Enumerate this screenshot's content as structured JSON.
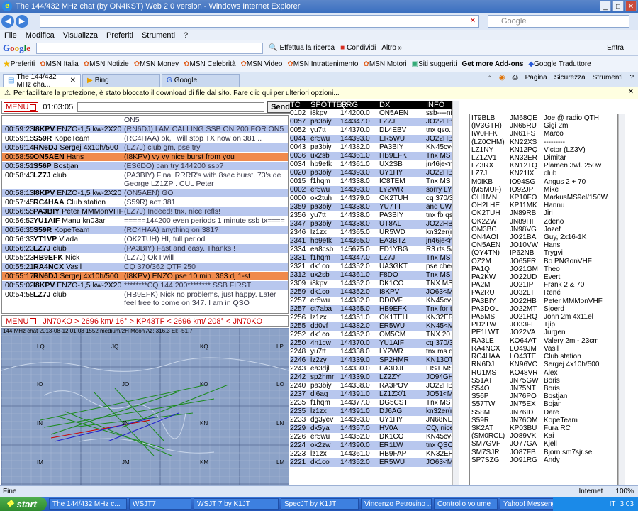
{
  "window": {
    "title": "The 144/432 MHz chat (by ON4KST) Web 2.0 version - Windows Internet Explorer"
  },
  "browser": {
    "search_placeholder": "Google",
    "menu": [
      "File",
      "Modifica",
      "Visualizza",
      "Preferiti",
      "Strumenti",
      "?"
    ],
    "google_buttons": [
      "Effettua la ricerca",
      "Condividi",
      "Altro »"
    ],
    "google_right": "Entra",
    "favorites_label": "Preferiti",
    "favorites": [
      "MSN Italia",
      "MSN Notizie",
      "MSN Money",
      "MSN Celebrità",
      "MSN Video",
      "MSN Intrattenimento",
      "MSN Motori",
      "Siti suggeriti",
      "Get more Add-ons",
      "Google Traduttore"
    ],
    "tabs": [
      "The 144/432 MHz cha...",
      "Bing",
      "Google"
    ],
    "tools": [
      "Pagina",
      "Sicurezza",
      "Strumenti"
    ],
    "infobar": "Per facilitare la protezione, è stato bloccato il download di file dal sito. Fare clic qui per ulteriori opzioni...",
    "status_left": "Fine",
    "status_zone": "Internet",
    "zoom": "100%"
  },
  "chat": {
    "menu_label": "MENU",
    "clock": "01:03:05",
    "send_label": "Send",
    "rows": [
      {
        "time": "",
        "call": "",
        "name": "",
        "msg": "ON5",
        "style": "white"
      },
      {
        "time": "00:59:23",
        "call": "I8KPV",
        "name": "ENZO-1,5 kw-2X20",
        "msg": "(RN6DJ) I AM CALLING SSB ON 200 FOR ON5",
        "style": "blue"
      },
      {
        "time": "00:59:15",
        "call": "S59R",
        "name": "KopeTeam",
        "msg": "(RC4HAA) ok, i will stop TX now on 381 ..",
        "style": "white"
      },
      {
        "time": "00:59:14",
        "call": "RN6DJ",
        "name": "Sergej 4x10h/500",
        "msg": "(LZ7J) club gm, pse try",
        "style": "blue"
      },
      {
        "time": "00:58:59",
        "call": "ON5AEN",
        "name": "Hans",
        "msg": "(I8KPV) vy vy nice burst from you",
        "style": "orange"
      },
      {
        "time": "00:58:51",
        "call": "S56P",
        "name": "Bostjan",
        "msg": "(ES6DO) can try 144200 ssb?",
        "style": "blue"
      },
      {
        "time": "00:58:43",
        "call": "LZ7J",
        "name": "club",
        "msg": "(PA3BIY) Final RRRR's with 8sec burst. 73's de George LZ1ZP . CUL Peter",
        "style": "white"
      },
      {
        "time": "00:58:13",
        "call": "I8KPV",
        "name": "ENZO-1,5 kw-2X20",
        "msg": "(ON5AEN) GO",
        "style": "blue"
      },
      {
        "time": "00:57:45",
        "call": "RC4HAA",
        "name": "Club station",
        "msg": "(S59R) вот 381",
        "style": "white"
      },
      {
        "time": "00:56:55",
        "call": "PA3BIY",
        "name": "Peter MMMonVHF",
        "msg": "(LZ7J) Indeed! tnx, nice refls!",
        "style": "blue"
      },
      {
        "time": "00:56:52",
        "call": "YU1AIF",
        "name": "Manu kn03ar",
        "msg": "=====144200 even periods 1 minute ssb tx====",
        "style": "white"
      },
      {
        "time": "00:56:35",
        "call": "S59R",
        "name": "KopeTeam",
        "msg": "(RC4HAA) anything on 381?",
        "style": "blue"
      },
      {
        "time": "00:56:33",
        "call": "YT1VP",
        "name": "Vlada",
        "msg": "(OK2TUH) HI, full period",
        "style": "white"
      },
      {
        "time": "00:56:23",
        "call": "LZ7J",
        "name": "club",
        "msg": "(PA3BIY) Fast and easy. Thanks !",
        "style": "blue"
      },
      {
        "time": "00:55:23",
        "call": "HB9EFK",
        "name": "Nick",
        "msg": "(LZ7J) Ok I will",
        "style": "white"
      },
      {
        "time": "00:55:21",
        "call": "RA4NCX",
        "name": "Vasil",
        "msg": "CQ 370/362 QTF 250",
        "style": "blue"
      },
      {
        "time": "00:55:17",
        "call": "RN6DJ",
        "name": "Sergej 4x10h/500",
        "msg": "(I8KPV) ENZO pse 10 min. 363 dj 1-st",
        "style": "orange"
      },
      {
        "time": "00:55:02",
        "call": "I8KPV",
        "name": "ENZO-1,5 kw-2X20",
        "msg": "********CQ 144.200******** SSB FIRST",
        "style": "blue"
      },
      {
        "time": "00:54:58",
        "call": "LZ7J",
        "name": "club",
        "msg": "(HB9EFK) Nick no problems, just happy. Later feel free to come on 347. I am in QSO",
        "style": "white"
      }
    ]
  },
  "map": {
    "menu_label": "MENU",
    "path_text": "JN70KO > 2696 km/ 16° > KP43TF < 2696 km/ 208° < JN70KO",
    "caption": "144 MHz chat  2013-08-12 01:03 1552 medium/2H  Moon Az: 316.3 El: -51.7",
    "labels": [
      "LQ",
      "JQ",
      "KQ",
      "LP",
      "IO",
      "JO",
      "KO",
      "LO",
      "IN",
      "JN",
      "KN",
      "LN",
      "IM",
      "JM",
      "KM",
      "LM"
    ]
  },
  "spotter": {
    "headers": [
      "TC",
      "SPOTTER",
      "QRG",
      "DX",
      "INFO"
    ],
    "rows": [
      [
        "0102",
        "i8kpv",
        "144200.0",
        "ON5AEN",
        "ssb----nice b"
      ],
      [
        "0057",
        "pa3biy",
        "144347.0",
        "LZ7J",
        "JO22HB<MS"
      ],
      [
        "0052",
        "yu7tt",
        "144370.0",
        "DL4EBV",
        "tnx qso..73"
      ],
      [
        "0044",
        "er5wu",
        "144393.0",
        "ER5WU",
        "JO22HB<MS"
      ],
      [
        "0043",
        "pa3biy",
        "144382.0",
        "PA3BIY",
        "KN45cv<MS"
      ],
      [
        "0036",
        "ux2sb",
        "144361.0",
        "HB9EFK",
        "Tnx MS QSO"
      ],
      [
        "0034",
        "hb9efk",
        "144361.0",
        "UX2SB",
        "jn46je<ms>"
      ],
      [
        "0020",
        "pa3biy",
        "144393.0",
        "UY1HY",
        "JO22HB<MS"
      ],
      [
        "0015",
        "f1hqm",
        "144338.0",
        "IC8TEM",
        "Tnx MS qso"
      ],
      [
        "0002",
        "er5wu",
        "144393.0",
        "LY2WR",
        "sorry LY!!! C"
      ],
      [
        "0000",
        "ok2tuh",
        "144379.0",
        "OK2TUH",
        "cq 370/379"
      ],
      [
        "2359",
        "pa3biy",
        "144338.0",
        "YU7TT",
        "and UW8SM"
      ],
      [
        "2356",
        "yu7tt",
        "144338.0",
        "PA3BIY",
        "tnx fb qso..7"
      ],
      [
        "2347",
        "pa3biy",
        "144338.0",
        "UT8AL",
        "JO22HB<MS"
      ],
      [
        "2346",
        "lz1zx",
        "144365.0",
        "UR5WD",
        "kn32er(ms)k"
      ],
      [
        "2341",
        "hb9efk",
        "144365.0",
        "EA3BTZ",
        "jn46je<ms>"
      ],
      [
        "2334",
        "ea8csb",
        "145675.0",
        "ED1YBG",
        "R3 rts 5/9 q"
      ],
      [
        "2331",
        "f1hqm",
        "144347.0",
        "LZ7J",
        "Tnx MS qso,"
      ],
      [
        "2321",
        "dk1co",
        "144352.0",
        "UA3GKT",
        "pse check s"
      ],
      [
        "2312",
        "ux2sb",
        "144361.0",
        "F8DO",
        "Tnx MS QSO"
      ],
      [
        "2309",
        "i8kpv",
        "144352.0",
        "DK1CO",
        "TNX MS QS"
      ],
      [
        "2259",
        "dk1co",
        "144352.0",
        "I8KPV",
        "JO63<MS><"
      ],
      [
        "2257",
        "er5wu",
        "144382.0",
        "DD0VF",
        "KN45cv<MS"
      ],
      [
        "2257",
        "ct7aba",
        "144365.0",
        "HB9EFK",
        "Tnx for the M"
      ],
      [
        "2256",
        "lz1zx",
        "144351.0",
        "OK1TEH",
        "KN32ER<MS"
      ],
      [
        "2255",
        "dd0vf",
        "144382.0",
        "ER5WU",
        "KN45<MS>"
      ],
      [
        "2252",
        "dk1co",
        "144352.0",
        "OM5CM",
        "TNX 20 sec"
      ],
      [
        "2250",
        "4n1cw",
        "144370.0",
        "YU1AIF",
        "cq  370/350"
      ],
      [
        "2248",
        "yu7tt",
        "144338.0",
        "LY2WR",
        "tnx ms qso."
      ],
      [
        "2246",
        "lz2zy",
        "144339.0",
        "SP2HMR",
        "KN13OT<MS"
      ],
      [
        "2243",
        "ea3djl",
        "144330.0",
        "EA3DJL",
        "LIST MS SS"
      ],
      [
        "2242",
        "sp2hmr",
        "144339.0",
        "LZ2ZY",
        "JO94GH<MS"
      ],
      [
        "2240",
        "pa3biy",
        "144338.0",
        "RA3POV",
        "JO22HB<MS"
      ],
      [
        "2237",
        "dj6ag",
        "144391.0",
        "LZ1ZX/1",
        "JO51<MS>H"
      ],
      [
        "2235",
        "f1hqm",
        "144377.0",
        "DG5CST",
        "Tnx MS qso,"
      ],
      [
        "2235",
        "lz1zx",
        "144391.0",
        "DJ6AG",
        "kn32er(ms)j"
      ],
      [
        "2233",
        "dg3yev",
        "144393.0",
        "UY1HY",
        "JN68NL<MS"
      ],
      [
        "2229",
        "dk5ya",
        "144357.0",
        "HV0A",
        "CQ, nice bu"
      ],
      [
        "2226",
        "er5wu",
        "144352.0",
        "DK1CO",
        "KN45cv<MS"
      ],
      [
        "2224",
        "ok2zw",
        "144390.0",
        "ER1LW",
        "tnx QSO, 73"
      ],
      [
        "2223",
        "lz1zx",
        "144361.0",
        "HB9FAP",
        "KN32ER(MS"
      ],
      [
        "2221",
        "dk1co",
        "144352.0",
        "ER5WU",
        "JO63<MS><"
      ]
    ]
  },
  "users": [
    [
      "IT9BLB",
      "JM68QE",
      "Joe @ radio QTH"
    ],
    [
      "(IV3GTH)",
      "JN65RU",
      "Gigi 2m"
    ],
    [
      "IW0FFK",
      "JN61FS",
      "Marco"
    ],
    [
      "(LZ0CHM)",
      "KN22XS",
      "---------"
    ],
    [
      "LZ1NY",
      "KN12PQ",
      "Victor (LZ3V)"
    ],
    [
      "LZ1ZV1",
      "KN32ER",
      "Dimitar"
    ],
    [
      "LZ3RX",
      "KN12TQ",
      "Plamen 3wl. 250w"
    ],
    [
      "LZ7J",
      "KN21IX",
      "club"
    ],
    [
      "M0IKB",
      "IO94SG",
      "Angus 2 + 70"
    ],
    [
      "(M5MUF)",
      "IO92JP",
      "Mike"
    ],
    [
      "OH1MN",
      "KP10FO",
      "MarkusMS9el/150W"
    ],
    [
      "OH2LHE",
      "KP11MK",
      "Hannu"
    ],
    [
      "OK2TUH",
      "JN89RB",
      "Jiri"
    ],
    [
      "OK2ZW",
      "JN89HI",
      "Zdeno"
    ],
    [
      "OM3BC",
      "JN98VG",
      "Jozef"
    ],
    [
      "ON4AOI",
      "JO21BA",
      "Guy, 2x16-1K"
    ],
    [
      "ON5AEN",
      "JO10VW",
      "Hans"
    ],
    [
      "(OY4TN)",
      "IP62NB",
      "Trygvi"
    ],
    [
      "OZ2M",
      "JO65FR",
      "Bo PNGonVHF"
    ],
    [
      "PA1Q",
      "JO21GM",
      "Theo"
    ],
    [
      "PA2KW",
      "JO22UD",
      "Evert"
    ],
    [
      "PA2M",
      "JO21IP",
      "Frank 2 & 70"
    ],
    [
      "PA2RU",
      "JO32LT",
      "René"
    ],
    [
      "PA3BIY",
      "JO22HB",
      "Peter MMMonVHF"
    ],
    [
      "PA3DOL",
      "JO22MT",
      "Sjoerd"
    ],
    [
      "PA5MS",
      "JO21RQ",
      "John 2m 4x11el"
    ],
    [
      "PD2TW",
      "JO33FI",
      "Tjip"
    ],
    [
      "PE1LWT",
      "JO22VA",
      "Jurgen"
    ],
    [
      "RA3LE",
      "KO64AT",
      "Valery 2m - 23cm"
    ],
    [
      "RA4NCX",
      "LO49JM",
      "Vasil"
    ],
    [
      "RC4HAA",
      "LO43TE",
      "Club station"
    ],
    [
      "RN6DJ",
      "KN96VC",
      "Sergej 4x10h/500"
    ],
    [
      "RU1MS",
      "KO48VR",
      "Alex"
    ],
    [
      "S51AT",
      "JN75GW",
      "Boris"
    ],
    [
      "S54O",
      "JN75NT",
      "Boris"
    ],
    [
      "S56P",
      "JN76PO",
      "Bostjan"
    ],
    [
      "S57TW",
      "JN75EX",
      "Bojan"
    ],
    [
      "S58M",
      "JN76ID",
      "Dare"
    ],
    [
      "S59R",
      "JN76OM",
      "KopeTeam"
    ],
    [
      "SK2AT",
      "KP03BU",
      "Fura RC"
    ],
    [
      "(SM0RCL)",
      "JO89VK",
      "Kai"
    ],
    [
      "SM7GVF",
      "JO77GA",
      "Kjell"
    ],
    [
      "SM7SJR",
      "JO87FB",
      "Bjorn sm7sjr.se"
    ],
    [
      "SP7SZG",
      "JO91RG",
      "Andy"
    ]
  ],
  "taskbar": {
    "start": "start",
    "tasks": [
      "The 144/432 MHz c...",
      "WSJT7",
      "WSJT 7  by K1JT",
      "SpecJT  by K1JT",
      "Vincenzo Petrosino ...",
      "Controllo volume",
      "Yahoo! Messenger"
    ],
    "clock": "3.03",
    "lang": "IT"
  }
}
